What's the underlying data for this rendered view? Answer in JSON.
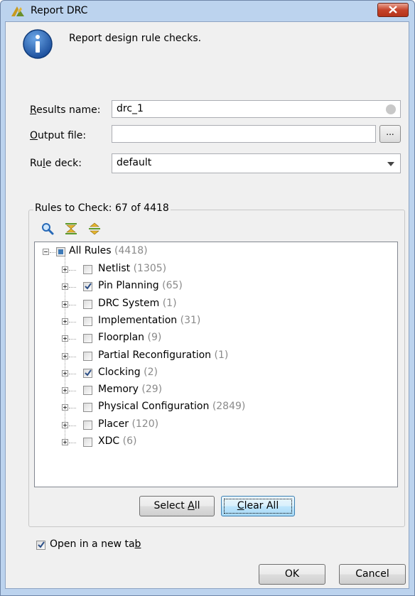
{
  "window": {
    "title": "Report DRC",
    "app_icon": "vivado-icon",
    "close_icon": "close-icon"
  },
  "info": {
    "icon": "info-icon",
    "text": "Report design rule checks."
  },
  "form": {
    "results_name": {
      "label_pre": "R",
      "label_rest": "esults name:",
      "value": "drc_1"
    },
    "output_file": {
      "label_pre": "O",
      "label_rest": "utput file:",
      "value": "",
      "browse_label": "..."
    },
    "rule_deck": {
      "label_pre": "Ru",
      "label_u": "l",
      "label_rest": "e deck:",
      "value": "default"
    }
  },
  "rules": {
    "group_title": "Rules to Check: 67 of 4418",
    "toolbar": [
      "search-icon",
      "collapse-all-icon",
      "expand-all-icon"
    ],
    "root": {
      "label": "All Rules",
      "count": "(4418)",
      "state": "partial"
    },
    "items": [
      {
        "label": "Netlist",
        "count": "(1305)",
        "checked": false
      },
      {
        "label": "Pin Planning",
        "count": "(65)",
        "checked": true
      },
      {
        "label": "DRC System",
        "count": "(1)",
        "checked": false
      },
      {
        "label": "Implementation",
        "count": "(31)",
        "checked": false
      },
      {
        "label": "Floorplan",
        "count": "(9)",
        "checked": false
      },
      {
        "label": "Partial Reconfiguration",
        "count": "(1)",
        "checked": false
      },
      {
        "label": "Clocking",
        "count": "(2)",
        "checked": true
      },
      {
        "label": "Memory",
        "count": "(29)",
        "checked": false
      },
      {
        "label": "Physical Configuration",
        "count": "(2849)",
        "checked": false
      },
      {
        "label": "Placer",
        "count": "(120)",
        "checked": false
      },
      {
        "label": "XDC",
        "count": "(6)",
        "checked": false
      }
    ],
    "select_all": {
      "pre": "Select ",
      "u": "A",
      "rest": "ll"
    },
    "clear_all": {
      "pre": "",
      "u": "C",
      "rest": "lear All"
    }
  },
  "open_new_tab": {
    "pre": "Open in a new ta",
    "u": "b",
    "checked": true
  },
  "buttons": {
    "ok": "OK",
    "cancel": "Cancel"
  }
}
